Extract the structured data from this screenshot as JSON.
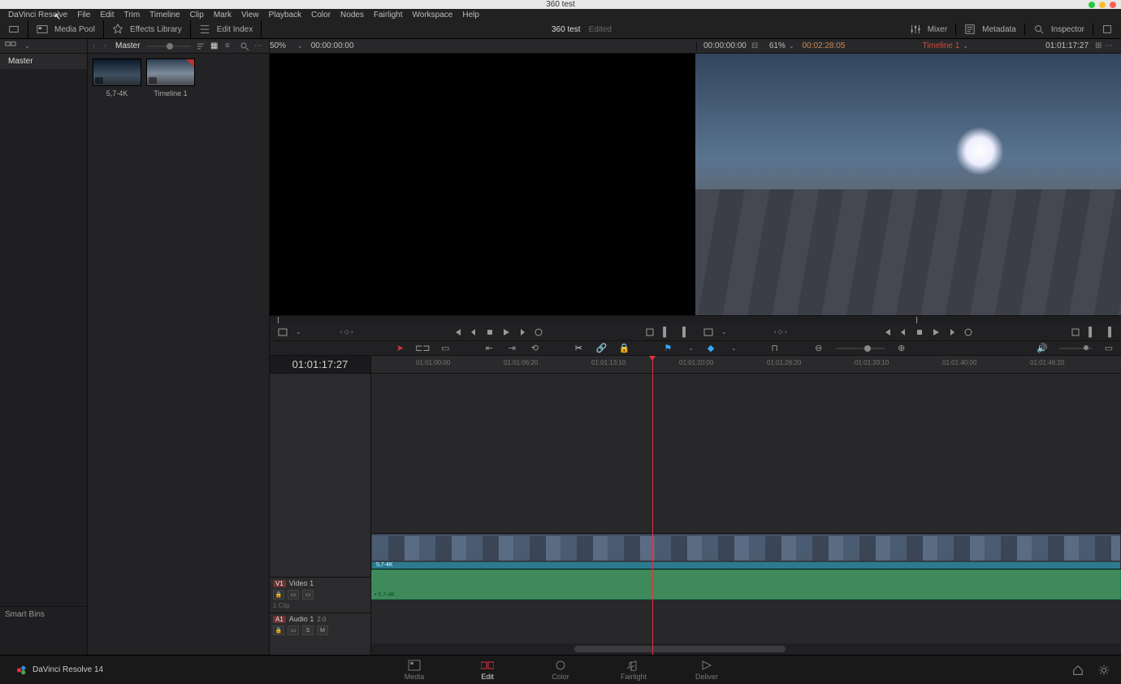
{
  "window": {
    "title": "360 test"
  },
  "menubar": [
    "DaVinci Resolve",
    "File",
    "Edit",
    "Trim",
    "Timeline",
    "Clip",
    "Mark",
    "View",
    "Playback",
    "Color",
    "Nodes",
    "Fairlight",
    "Workspace",
    "Help"
  ],
  "toolbar": {
    "media_pool": "Media Pool",
    "effects_library": "Effects Library",
    "edit_index": "Edit Index",
    "project": "360 test",
    "status": "Edited",
    "mixer": "Mixer",
    "metadata": "Metadata",
    "inspector": "Inspector"
  },
  "bins": {
    "current": "Master",
    "tree": [
      "Master"
    ],
    "smart_label": "Smart Bins"
  },
  "clips": [
    {
      "name": "5,7-4K",
      "used": false
    },
    {
      "name": "Timeline 1",
      "used": true
    }
  ],
  "source": {
    "zoom": "50%",
    "tc": "00:00:00:00"
  },
  "program": {
    "tc_left": "00:00:00:00",
    "zoom": "61%",
    "duration": "00:02:28:05",
    "timeline_name": "Timeline 1",
    "tc_right": "01:01:17:27"
  },
  "timeline": {
    "timecode": "01:01:17:27",
    "ruler": [
      "01:01:00:00",
      "01:01:06:20",
      "01:01:13:10",
      "01:01:20:00",
      "01:01:26:20",
      "01:01:33:10",
      "01:01:40:00",
      "01:01:46:20"
    ],
    "ruler_pos": [
      55,
      163,
      271,
      379,
      487,
      595,
      703,
      811
    ],
    "video_track": {
      "tag": "V1",
      "name": "Video 1",
      "clip_label": "5,7-4K",
      "clip_count": "1 Clip"
    },
    "audio_track": {
      "tag": "A1",
      "name": "Audio 1",
      "channels": "2.0",
      "clip_label": "5,7-4K"
    }
  },
  "pages": {
    "media": "Media",
    "edit": "Edit",
    "color": "Color",
    "fairlight": "Fairlight",
    "deliver": "Deliver"
  },
  "app": {
    "name": "DaVinci Resolve 14"
  }
}
